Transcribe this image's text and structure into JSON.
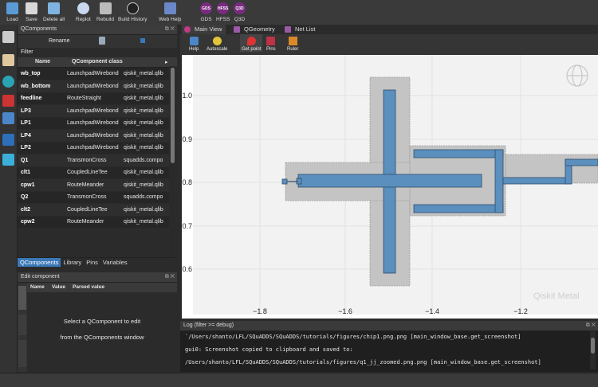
{
  "toolbar": {
    "buttons": [
      {
        "label": "Load",
        "icon": "folder-icon"
      },
      {
        "label": "Save",
        "icon": "save-icon"
      },
      {
        "label": "Delete all",
        "icon": "delete-all-icon"
      },
      {
        "label": "Replot",
        "icon": "replot-icon"
      },
      {
        "label": "Rebuild",
        "icon": "rebuild-icon"
      },
      {
        "label": "Build History",
        "icon": "history-icon"
      },
      {
        "label": "Web Help",
        "icon": "web-help-icon"
      },
      {
        "label": "GDS",
        "icon": "gds-icon",
        "badge": "GDS"
      },
      {
        "label": "HFSS",
        "icon": "hfss-icon",
        "badge": "HFSS"
      },
      {
        "label": "Q3D",
        "icon": "q3d-icon",
        "badge": "Q3D"
      }
    ]
  },
  "qcomponents_panel": {
    "title": "QComponents",
    "rename_label": "Rename",
    "filter_label": "Filter",
    "columns": [
      "Name",
      "QComponent class",
      "..."
    ],
    "rows": [
      {
        "name": "wb_top",
        "cls": "LaunchpadWirebond",
        "mod": "qiskit_metal.qlib"
      },
      {
        "name": "wb_bottom",
        "cls": "LaunchpadWirebond",
        "mod": "qiskit_metal.qlib"
      },
      {
        "name": "feedline",
        "cls": "RouteStraight",
        "mod": "qiskit_metal.qlib"
      },
      {
        "name": "LP3",
        "cls": "LaunchpadWirebond",
        "mod": "qiskit_metal.qlib"
      },
      {
        "name": "LP1",
        "cls": "LaunchpadWirebond",
        "mod": "qiskit_metal.qlib"
      },
      {
        "name": "LP4",
        "cls": "LaunchpadWirebond",
        "mod": "qiskit_metal.qlib"
      },
      {
        "name": "LP2",
        "cls": "LaunchpadWirebond",
        "mod": "qiskit_metal.qlib"
      },
      {
        "name": "Q1",
        "cls": "TransmonCross",
        "mod": "squadds.compo"
      },
      {
        "name": "clt1",
        "cls": "CoupledLineTee",
        "mod": "qiskit_metal.qlib"
      },
      {
        "name": "cpw1",
        "cls": "RouteMeander",
        "mod": "qiskit_metal.qlib"
      },
      {
        "name": "Q2",
        "cls": "TransmonCross",
        "mod": "squadds.compo"
      },
      {
        "name": "clt2",
        "cls": "CoupledLineTee",
        "mod": "qiskit_metal.qlib"
      },
      {
        "name": "cpw2",
        "cls": "RouteMeander",
        "mod": "qiskit_metal.qlib"
      }
    ],
    "tabs": [
      "QComponents",
      "Library",
      "Pins",
      "Variables"
    ]
  },
  "edit_panel": {
    "title": "Edit component",
    "columns": [
      "Name",
      "Value",
      "Parsed value"
    ],
    "message_line1": "Select a QComponent to edit",
    "message_line2": "from the QComponents window",
    "side_tabs": [
      "Options",
      "Help",
      "Source"
    ]
  },
  "main_view": {
    "tabs": [
      "Main View",
      "QGeometry",
      "Net List"
    ],
    "tools": [
      {
        "label": "Help",
        "icon": "help-icon"
      },
      {
        "label": "Autoscale",
        "icon": "autoscale-icon"
      },
      {
        "label": "Get point",
        "icon": "get-point-icon"
      },
      {
        "label": "Pins",
        "icon": "pins-icon"
      },
      {
        "label": "Ruler",
        "icon": "ruler-icon"
      }
    ],
    "watermark": "Qiskit Metal",
    "x_ticks": [
      "−1.8",
      "−1.6",
      "−1.4",
      "−1.2"
    ],
    "y_ticks": [
      "1.0",
      "0.9",
      "0.8",
      "0.7",
      "0.6"
    ]
  },
  "log": {
    "title": "Log  (filter >= debug)",
    "lines": [
      "`/Users/shanto/LFL/SQuADDS/SQuADDS/tutorials/figures/chip1.png.png [main_window_base.get_screenshot]",
      "gui0: Screenshot copied to clipboard and saved to:",
      " /Users/shanto/LFL/SQuADDS/SQuADDS/tutorials/figures/q1_jj_zoomed.png.png [main_window_base.get_screenshot]"
    ]
  },
  "colors": {
    "accent": "#3a78b8",
    "metal": "#5b8fbd",
    "gap": "#c4c4c4"
  }
}
